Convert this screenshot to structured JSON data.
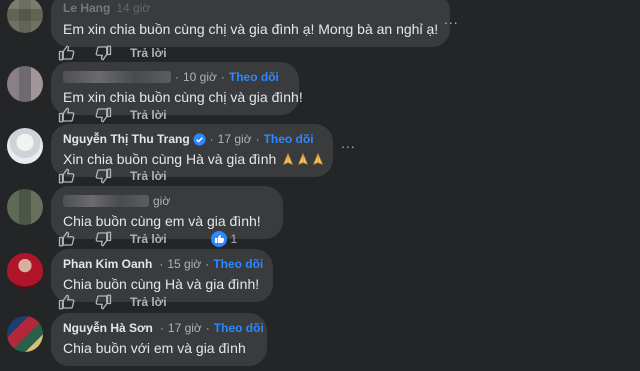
{
  "comments": [
    {
      "name": "Le Hang",
      "time": "14 giờ",
      "text": "Em xin chia buồn cùng chị và gia đình ạ! Mong bà an nghỉ ạ!",
      "reply_label": "Trả lời"
    },
    {
      "name": "",
      "time": "10 giờ",
      "dot": "·",
      "follow_label": "Theo dõi",
      "text": "Em xin chia buồn cùng chị và gia đình!",
      "reply_label": "Trả lời"
    },
    {
      "name": "Nguyễn Thị Thu Trang",
      "time": "17 giờ",
      "dot": "·",
      "follow_label": "Theo dõi",
      "text": "Xin chia buồn cùng Hà và gia đình",
      "reply_label": "Trả lời"
    },
    {
      "name": "",
      "time": "giờ",
      "text": "Chia buồn cùng em và gia đình!",
      "reply_label": "Trả lời",
      "reaction_count": "1"
    },
    {
      "name": "Phan Kim Oanh",
      "time": "15 giờ",
      "dot": "·",
      "follow_label": "Theo dõi",
      "text": "Chia buồn cùng Hà và gia đình!",
      "reply_label": "Trả lời"
    },
    {
      "name": "Nguyễn Hà Sơn",
      "time": "17 giờ",
      "dot": "·",
      "follow_label": "Theo dõi",
      "text": "Chia buồn với em và gia đình"
    }
  ],
  "more_label": "...",
  "colors": {
    "background": "#242526",
    "bubble": "#3a3b3c",
    "follow": "#2d88ff",
    "secondary_text": "#b0b3b8"
  },
  "icons": [
    "like-icon",
    "dislike-icon",
    "verified-badge-icon",
    "more-options-icon",
    "folded-hands-emoji",
    "like-reaction-icon"
  ]
}
